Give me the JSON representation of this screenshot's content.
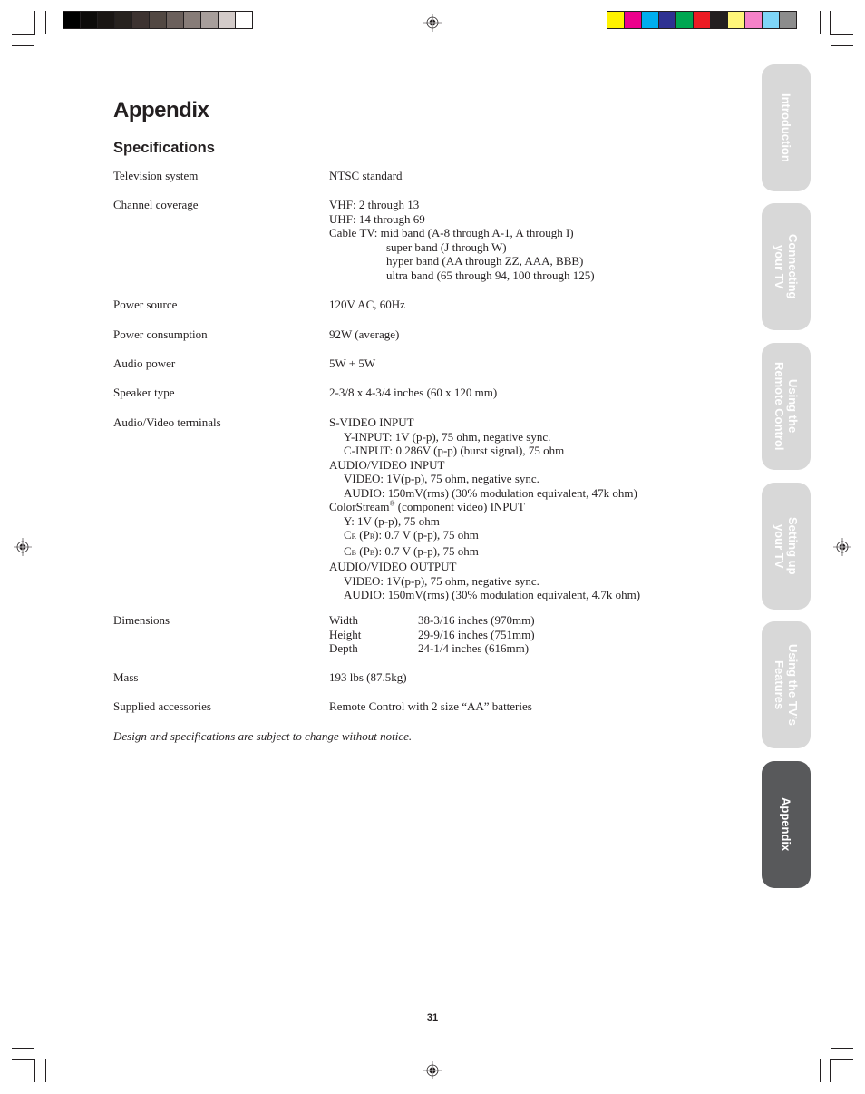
{
  "page": {
    "title": "Appendix",
    "section": "Specifications",
    "page_number": "31",
    "note": "Design and specifications are subject to change without notice."
  },
  "specs": {
    "television_system": {
      "label": "Television system",
      "value": "NTSC standard"
    },
    "channel_coverage": {
      "label": "Channel coverage",
      "vhf": "VHF: 2 through 13",
      "uhf": "UHF: 14 through 69",
      "cable_prefix": "Cable TV:",
      "cable_bands": [
        "mid band (A-8 through A-1, A through I)",
        "super band (J through W)",
        "hyper band (AA through ZZ, AAA, BBB)",
        "ultra band (65 through 94, 100 through 125)"
      ]
    },
    "power_source": {
      "label": "Power source",
      "value": "120V AC, 60Hz"
    },
    "power_consumption": {
      "label": "Power consumption",
      "value": "92W (average)"
    },
    "audio_power": {
      "label": "Audio power",
      "value": "5W + 5W"
    },
    "speaker_type": {
      "label": "Speaker type",
      "value": "2-3/8 x 4-3/4 inches (60 x 120 mm)"
    },
    "av_terminals": {
      "label": "Audio/Video terminals",
      "svideo_heading": "S-VIDEO INPUT",
      "svideo_y": "Y-INPUT: 1V (p-p), 75 ohm, negative sync.",
      "svideo_c": "C-INPUT: 0.286V (p-p) (burst signal), 75 ohm",
      "av_in_heading": "AUDIO/VIDEO INPUT",
      "av_in_video": "VIDEO: 1V(p-p), 75 ohm, negative sync.",
      "av_in_audio": "AUDIO: 150mV(rms) (30% modulation equivalent, 47k ohm)",
      "colorstream_name": "ColorStream",
      "colorstream_mark": "®",
      "colorstream_rest": " (component video) INPUT",
      "cs_y": "Y: 1V (p-p), 75 ohm",
      "cs_cr_c": "C",
      "cs_cr_sub": "R",
      "cs_cr_mid": " (P",
      "cs_cr_sub2": "R",
      "cs_cr_rest": "): 0.7 V (p-p), 75 ohm",
      "cs_cb_c": "C",
      "cs_cb_sub": "B",
      "cs_cb_mid": " (P",
      "cs_cb_sub2": "B",
      "cs_cb_rest": "): 0.7 V (p-p), 75 ohm",
      "av_out_heading": "AUDIO/VIDEO OUTPUT",
      "av_out_video": "VIDEO: 1V(p-p), 75 ohm, negative sync.",
      "av_out_audio": "AUDIO: 150mV(rms) (30% modulation equivalent, 4.7k ohm)"
    },
    "dimensions": {
      "label": "Dimensions",
      "rows": [
        {
          "name": "Width",
          "value": "38-3/16 inches (970mm)"
        },
        {
          "name": "Height",
          "value": "29-9/16 inches (751mm)"
        },
        {
          "name": "Depth",
          "value": "24-1/4 inches (616mm)"
        }
      ]
    },
    "mass": {
      "label": "Mass",
      "value": "193 lbs (87.5kg)"
    },
    "accessories": {
      "label": "Supplied accessories",
      "value": "Remote Control with 2 size “AA” batteries"
    }
  },
  "side_tabs": [
    {
      "label": "Introduction",
      "active": false
    },
    {
      "label": "Connecting\nyour TV",
      "active": false
    },
    {
      "label": "Using the\nRemote Control",
      "active": false
    },
    {
      "label": "Setting up\nyour TV",
      "active": false
    },
    {
      "label": "Using the TV’s\nFeatures",
      "active": false
    },
    {
      "label": "Appendix",
      "active": true
    }
  ],
  "print_marks": {
    "gray_swatches": [
      "#000000",
      "#0d0b0a",
      "#1a1614",
      "#27221f",
      "#3d3331",
      "#524843",
      "#6b605c",
      "#877c78",
      "#a79e9b",
      "#d3cbc9",
      "#ffffff"
    ],
    "color_swatches": [
      "#fff200",
      "#ec008c",
      "#00aeef",
      "#2e3192",
      "#00a651",
      "#ed1c24",
      "#231f20",
      "#fff57a",
      "#f582c8",
      "#7fd5f7",
      "#8c8c8c"
    ]
  }
}
